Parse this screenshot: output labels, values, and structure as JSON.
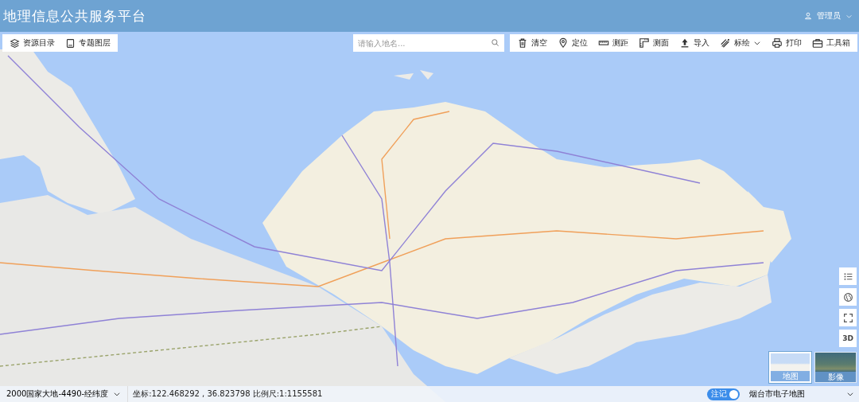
{
  "header": {
    "title": "地理信息公共服务平台",
    "user": "管理员"
  },
  "left_tools": [
    {
      "label": "资源目录"
    },
    {
      "label": "专题图层"
    }
  ],
  "search": {
    "placeholder": "请输入地名..."
  },
  "toolbar": [
    {
      "label": "清空",
      "dropdown": false
    },
    {
      "label": "定位",
      "dropdown": false
    },
    {
      "label": "测距",
      "dropdown": false
    },
    {
      "label": "测面",
      "dropdown": false
    },
    {
      "label": "导入",
      "dropdown": false
    },
    {
      "label": "标绘",
      "dropdown": true
    },
    {
      "label": "打印",
      "dropdown": false
    },
    {
      "label": "工具箱",
      "dropdown": false
    }
  ],
  "map_controls": [
    {
      "kind": "list"
    },
    {
      "kind": "globe"
    },
    {
      "kind": "fullscreen"
    },
    {
      "kind": "text",
      "label": "3D"
    }
  ],
  "basemaps": [
    {
      "label": "地图",
      "kind": "vector",
      "selected": true
    },
    {
      "label": "影像",
      "kind": "satellite",
      "selected": false
    }
  ],
  "status_bar": {
    "crs": "2000国家大地-4490-经纬度",
    "coords": "坐标:122.468292 , 36.823798 比例尺:1:1155581",
    "annotation": {
      "label": "注记",
      "on": true
    },
    "layer": "烟台市电子地图"
  }
}
